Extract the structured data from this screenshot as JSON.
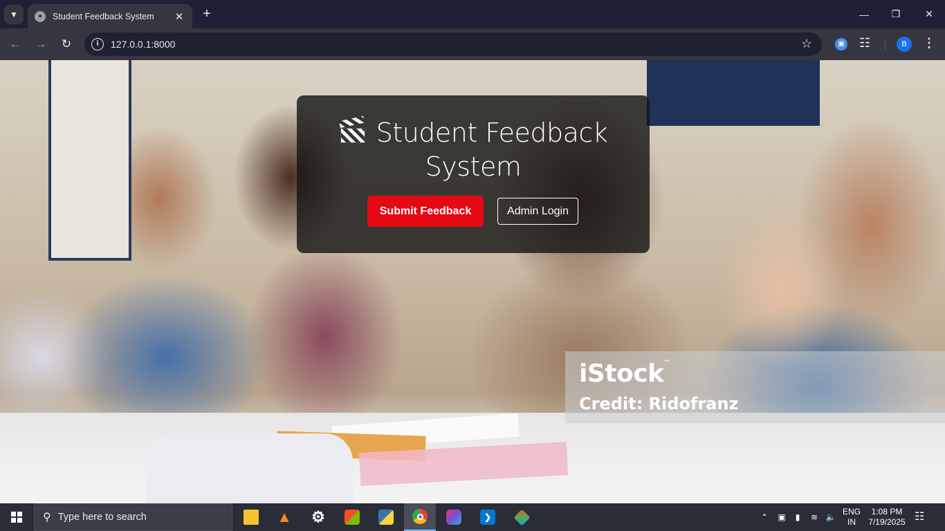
{
  "browser": {
    "tab_title": "Student Feedback System",
    "url": "127.0.0.1:8000",
    "profile_initial": "B"
  },
  "hero": {
    "title_line1": "Student Feedback",
    "title_line2": "System",
    "submit_label": "Submit Feedback",
    "admin_label": "Admin Login",
    "accent_color": "#e50914"
  },
  "watermark": {
    "logo": "iStock",
    "tm": "™",
    "credit": "Credit: Ridofranz"
  },
  "taskbar": {
    "search_placeholder": "Type here to search",
    "lang_line1": "ENG",
    "lang_line2": "IN",
    "time": "1:08 PM",
    "date": "7/19/2025",
    "apps": [
      "file-explorer",
      "vlc",
      "settings",
      "microsoft-store",
      "python-idle",
      "chrome",
      "microsoft-365",
      "vscode",
      "git"
    ]
  }
}
